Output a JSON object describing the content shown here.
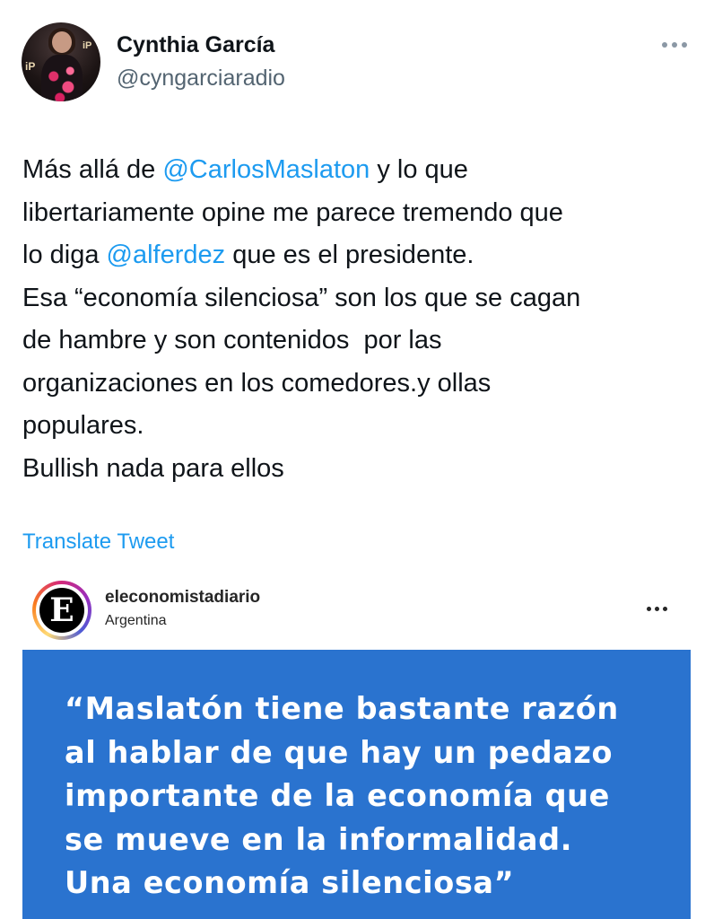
{
  "author": {
    "display_name": "Cynthia García",
    "handle": "@cyngarciaradio",
    "avatar_icon": "profile-photo"
  },
  "menu_icon": "more-horizontal-icon",
  "tweet": {
    "lines": [
      [
        {
          "t": "Más allá de "
        },
        {
          "t": "@CarlosMaslaton",
          "mention": true
        },
        {
          "t": " y lo que"
        }
      ],
      [
        {
          "t": "libertariamente opine me parece tremendo que"
        }
      ],
      [
        {
          "t": "lo diga "
        },
        {
          "t": "@alferdez",
          "mention": true
        },
        {
          "t": " que es el presidente."
        }
      ],
      [
        {
          "t": "Esa “economía silenciosa” son los que se cagan"
        }
      ],
      [
        {
          "t": "de hambre y son contenidos  por las"
        }
      ],
      [
        {
          "t": "organizaciones en los comedores.y ollas"
        }
      ],
      [
        {
          "t": "populares."
        }
      ],
      [
        {
          "t": "Bullish nada para ellos"
        }
      ]
    ],
    "translate_label": "Translate Tweet"
  },
  "embedded_post": {
    "account": "eleconomistadiario",
    "location": "Argentina",
    "avatar_letter": "E",
    "quote_lines": [
      "“Maslatón tiene bastante razón",
      "al hablar de que hay un pedazo",
      "importante de la economía que",
      "se mueve en la informalidad.",
      "Una economía silenciosa”"
    ],
    "card_color": "#2a73cf"
  },
  "colors": {
    "link": "#1d9bf0",
    "secondary_text": "#536471"
  }
}
